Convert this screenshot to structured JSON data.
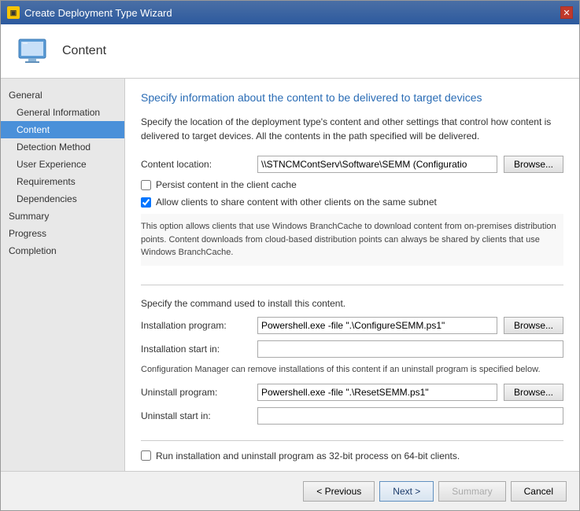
{
  "window": {
    "title": "Create Deployment Type Wizard",
    "close_label": "✕"
  },
  "header": {
    "title": "Content"
  },
  "sidebar": {
    "sections": [
      {
        "label": "General",
        "items": [
          {
            "id": "general-information",
            "label": "General Information",
            "active": false
          },
          {
            "id": "content",
            "label": "Content",
            "active": true
          },
          {
            "id": "detection-method",
            "label": "Detection Method",
            "active": false
          },
          {
            "id": "user-experience",
            "label": "User Experience",
            "active": false
          },
          {
            "id": "requirements",
            "label": "Requirements",
            "active": false
          },
          {
            "id": "dependencies",
            "label": "Dependencies",
            "active": false
          }
        ]
      },
      {
        "label": "",
        "items": [
          {
            "id": "summary",
            "label": "Summary",
            "active": false
          },
          {
            "id": "progress",
            "label": "Progress",
            "active": false
          },
          {
            "id": "completion",
            "label": "Completion",
            "active": false
          }
        ]
      }
    ]
  },
  "main": {
    "title": "Specify information about the content to be delivered to target devices",
    "description": "Specify the location of the deployment type's content and other settings that control how content is delivered to target devices. All the contents in the path specified will be delivered.",
    "content_location_label": "Content location:",
    "content_location_value": "\\\\STNCMContServ\\Software\\SEMM (Configuratio",
    "content_location_placeholder": "",
    "browse_label": "Browse...",
    "persist_cache_label": "Persist content in the client cache",
    "persist_cache_checked": false,
    "allow_share_label": "Allow clients to share content with other clients on the same subnet",
    "allow_share_checked": true,
    "branch_cache_info": "This option allows clients that use Windows BranchCache to download content from on-premises distribution points. Content downloads from cloud-based distribution points can always be shared by clients that use Windows BranchCache.",
    "install_section_label": "Specify the command used to install this content.",
    "installation_program_label": "Installation program:",
    "installation_program_value": "Powershell.exe -file \".\\ConfigureSEMM.ps1\"",
    "installation_start_label": "Installation start in:",
    "installation_start_value": "",
    "config_note": "Configuration Manager can remove installations of this content if an uninstall program is specified below.",
    "uninstall_program_label": "Uninstall program:",
    "uninstall_program_value": "Powershell.exe -file \".\\ResetSEMM.ps1\"",
    "uninstall_start_label": "Uninstall start in:",
    "uninstall_start_value": "",
    "run_32bit_label": "Run installation and uninstall program as 32-bit process on 64-bit clients.",
    "run_32bit_checked": false
  },
  "footer": {
    "previous_label": "< Previous",
    "next_label": "Next >",
    "summary_label": "Summary",
    "cancel_label": "Cancel"
  }
}
